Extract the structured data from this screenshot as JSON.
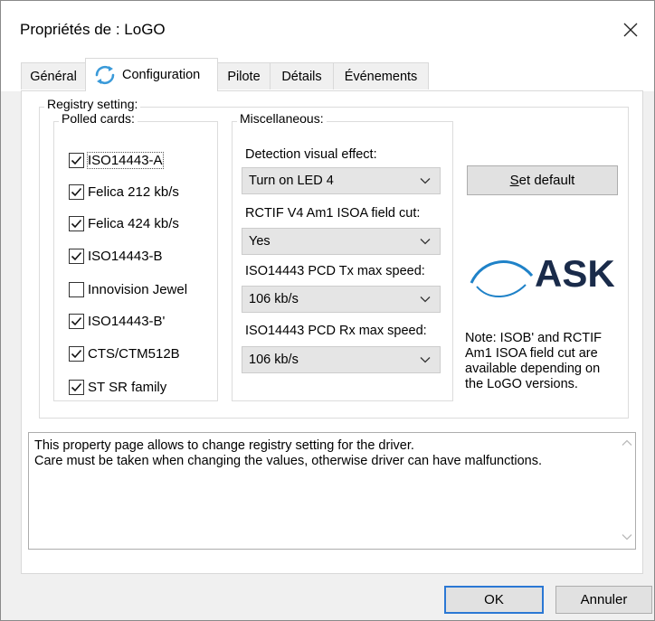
{
  "window": {
    "title": "Propriétés de : LoGO"
  },
  "tabs": [
    {
      "label": "Général"
    },
    {
      "label": "Configuration"
    },
    {
      "label": "Pilote"
    },
    {
      "label": "Détails"
    },
    {
      "label": "Événements"
    }
  ],
  "registry": {
    "legend": "Registry setting:",
    "polled": {
      "legend": "Polled cards:",
      "items": [
        {
          "label": "ISO14443-A",
          "checked": true
        },
        {
          "label": "Felica 212 kb/s",
          "checked": true
        },
        {
          "label": "Felica 424 kb/s",
          "checked": true
        },
        {
          "label": "ISO14443-B",
          "checked": true
        },
        {
          "label": "Innovision Jewel",
          "checked": false
        },
        {
          "label": "ISO14443-B'",
          "checked": true
        },
        {
          "label": "CTS/CTM512B",
          "checked": true
        },
        {
          "label": "ST SR family",
          "checked": true
        }
      ]
    },
    "misc": {
      "legend": "Miscellaneous:",
      "fields": [
        {
          "label": "Detection visual effect:",
          "value": "Turn on LED 4"
        },
        {
          "label": "RCTIF V4 Am1 ISOA field cut:",
          "value": "Yes"
        },
        {
          "label": "ISO14443 PCD Tx max speed:",
          "value": "106 kb/s"
        },
        {
          "label": "ISO14443 PCD Rx max speed:",
          "value": "106 kb/s"
        }
      ]
    },
    "set_default": {
      "prefix": "S",
      "rest": "et default"
    },
    "logo_text": "ASK",
    "note": "Note: ISOB' and RCTIF\nAm1 ISOA field cut are\navailable depending on\nthe LoGO versions."
  },
  "info": "This property page allows to change registry setting for the driver.\nCare must be taken when changing the values, otherwise driver can have malfunctions.",
  "buttons": {
    "ok": "OK",
    "cancel": "Annuler"
  },
  "colors": {
    "accent": "#2b78d4",
    "logo_arc": "#1f82c8",
    "logo_text": "#1a2b4a",
    "config_icon": "#3a9ad9"
  }
}
